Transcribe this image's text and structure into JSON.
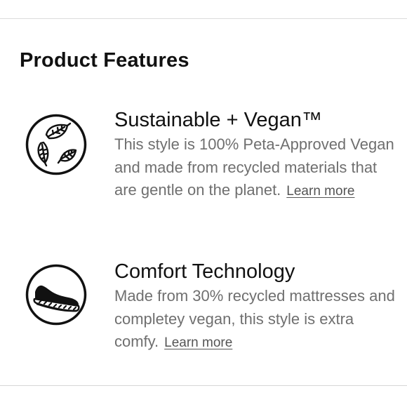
{
  "section": {
    "title": "Product Features"
  },
  "features": [
    {
      "title": "Sustainable + Vegan™",
      "description": "This style is 100% Peta-Approved Vegan and made from recycled materials that are gentle on the planet.",
      "link_label": "Learn more",
      "icon": "leaf-recycle-icon"
    },
    {
      "title": "Comfort Technology",
      "description": "Made from 30% recycled mattresses and completey vegan, this style is extra comfy.",
      "link_label": "Learn more",
      "icon": "shoe-icon"
    }
  ],
  "colors": {
    "heading": "#111111",
    "body_text": "#6f6f6f",
    "link": "#555555",
    "divider": "#dcdcdc"
  }
}
